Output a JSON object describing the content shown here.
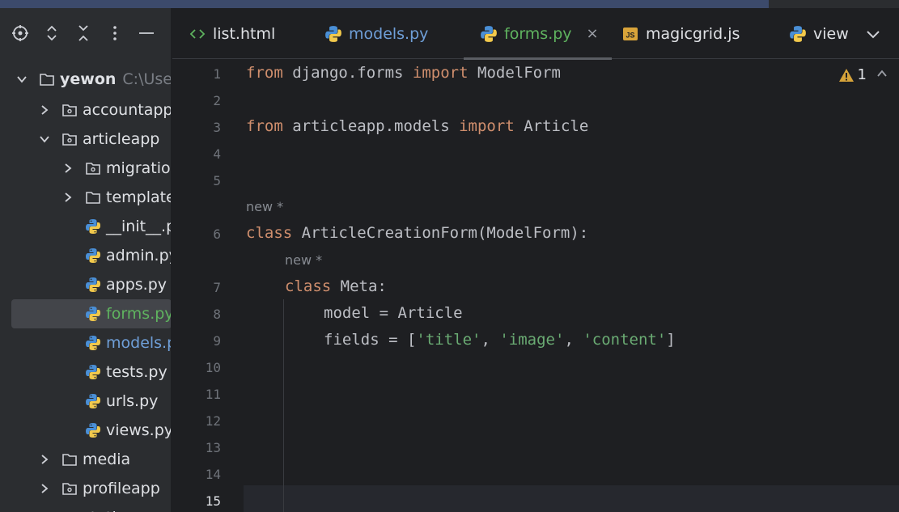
{
  "colors": {
    "background": "#1e1f22",
    "sidebar": "#2b2d30",
    "keyword": "#cf8e6d",
    "string": "#6aab73",
    "modified_file": "#5fb35f",
    "vcs_file": "#6f9fd8"
  },
  "toolbar": {
    "icons": [
      "crosshair-icon",
      "expand-icon",
      "collapse-icon",
      "more-vertical-icon",
      "minimize-icon"
    ]
  },
  "tree": {
    "project_name": "yewon",
    "project_path": "C:\\Use",
    "items": [
      {
        "label": "accountapp",
        "type": "package"
      },
      {
        "label": "articleapp",
        "type": "package"
      },
      {
        "label": "migration",
        "type": "package"
      },
      {
        "label": "template",
        "type": "folder"
      },
      {
        "label": "__init__.p",
        "type": "python"
      },
      {
        "label": "admin.py",
        "type": "python"
      },
      {
        "label": "apps.py",
        "type": "python"
      },
      {
        "label": "forms.py",
        "type": "python"
      },
      {
        "label": "models.p",
        "type": "python"
      },
      {
        "label": "tests.py",
        "type": "python"
      },
      {
        "label": "urls.py",
        "type": "python"
      },
      {
        "label": "views.py",
        "type": "python"
      },
      {
        "label": "media",
        "type": "folder"
      },
      {
        "label": "profileapp",
        "type": "package"
      },
      {
        "label": "static",
        "type": "folder"
      }
    ]
  },
  "tabs": [
    {
      "label": "list.html",
      "icon": "html-icon"
    },
    {
      "label": "models.py",
      "icon": "python-icon"
    },
    {
      "label": "forms.py",
      "icon": "python-icon",
      "active": true
    },
    {
      "label": "magicgrid.js",
      "icon": "js-icon"
    },
    {
      "label": "view",
      "icon": "python-icon"
    }
  ],
  "tab_close": "×",
  "editor": {
    "warnings_count": "1",
    "line_numbers": [
      "1",
      "2",
      "3",
      "4",
      "5",
      "6",
      "7",
      "8",
      "9",
      "10",
      "11",
      "12",
      "13",
      "14",
      "15"
    ],
    "hints": [
      "new *",
      "new *"
    ],
    "lines": {
      "l1": {
        "k1": "from",
        "t1": " django.forms ",
        "k2": "import",
        "t2": " ModelForm"
      },
      "l3": {
        "k1": "from",
        "t1": " articleapp.models ",
        "k2": "import",
        "t2": " Article"
      },
      "l6": {
        "k1": "class",
        "t1": " ArticleCreationForm(ModelForm):"
      },
      "l7": {
        "k1": "class",
        "t1": " Meta:"
      },
      "l8": {
        "t1": "model = Article"
      },
      "l9": {
        "t1": "fields = [",
        "s1": "'title'",
        "t2": ", ",
        "s2": "'image'",
        "t3": ", ",
        "s3": "'content'",
        "t4": "]"
      }
    }
  }
}
